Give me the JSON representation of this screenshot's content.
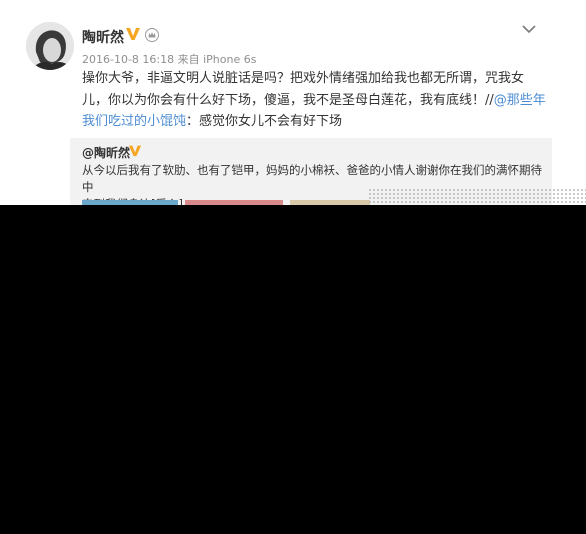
{
  "post": {
    "username": "陶昕然",
    "meta": "2016-10-8 16:18 来自 iPhone 6s",
    "text_line1": "操你大爷，非逼文明人说脏话是吗？把戏外情绪强加给我也都无所谓，咒我女",
    "text_line2": "儿，你以为你会有什么好下场，傻逼，我不是圣母白莲花，我有底线！//",
    "mention": "@那些年",
    "text_line3_link": "我们吃过的小馄饨",
    "text_line3_rest": "：感觉你女儿不会有好下场"
  },
  "repost": {
    "username": "@陶昕然",
    "text_line1": "从今以后我有了软肋、也有了铠甲，妈妈的小棉袄、爸爸的小情人谢谢你在我们的满怀期待中",
    "text_line2": "来到我们身边[爱心]"
  },
  "icons": {
    "verified": "verified-v-icon",
    "member": "member-crown-icon",
    "menu": "chevron-down-icon"
  },
  "colors": {
    "link": "#4c8cd2",
    "verified": "#f5a623",
    "redaction": "#000000"
  }
}
